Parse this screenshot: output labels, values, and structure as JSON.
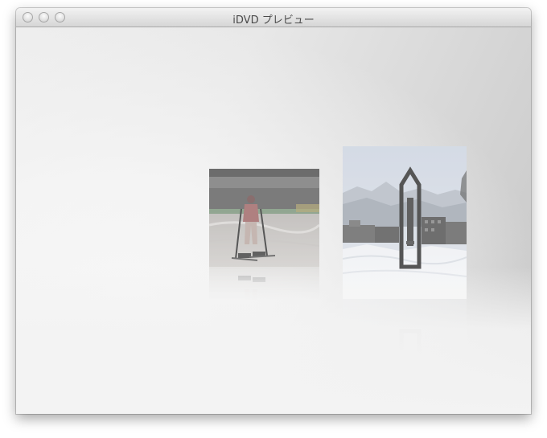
{
  "window": {
    "title": "iDVD プレビュー",
    "controls": [
      "close-button",
      "minimize-button",
      "zoom-button"
    ]
  },
  "preview": {
    "photos": [
      {
        "subject": "skier-photo"
      },
      {
        "subject": "snow-monument-photo"
      }
    ]
  }
}
